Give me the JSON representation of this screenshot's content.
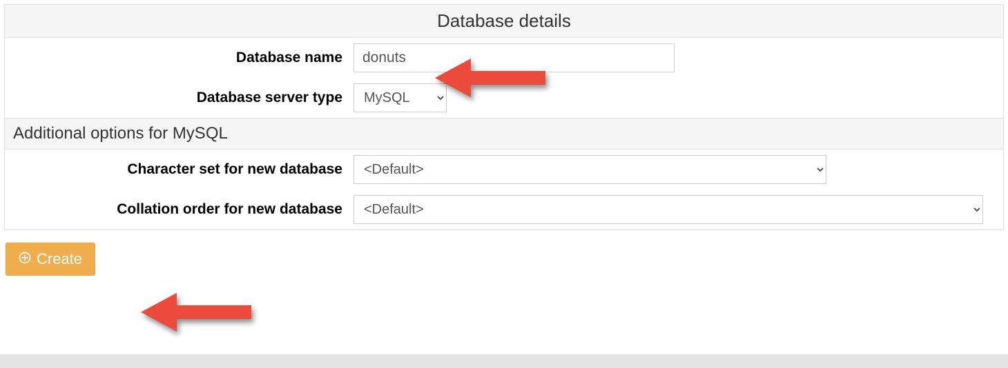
{
  "header": {
    "title": "Database details"
  },
  "fields": {
    "db_name_label": "Database name",
    "db_name_value": "donuts",
    "server_type_label": "Database server type",
    "server_type_value": "MySQL"
  },
  "section": {
    "title": "Additional options for MySQL"
  },
  "options": {
    "charset_label": "Character set for new database",
    "charset_value": "<Default>",
    "collation_label": "Collation order for new database",
    "collation_value": "<Default>"
  },
  "button": {
    "create_label": "Create"
  },
  "colors": {
    "accent": "#f0ad4e",
    "arrow": "#ec4a3b"
  }
}
